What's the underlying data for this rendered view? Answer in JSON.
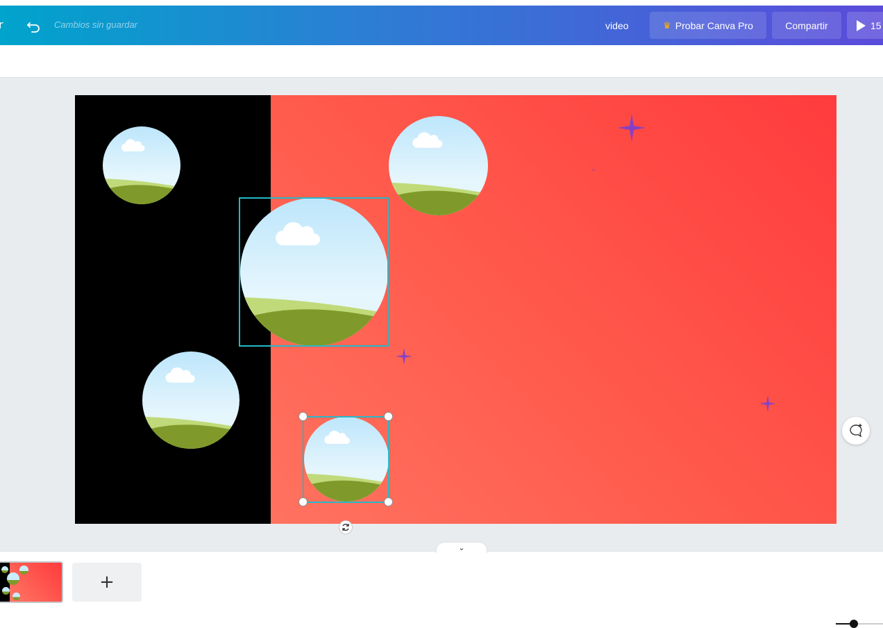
{
  "toolbar": {
    "edge_glyph": "r",
    "save_status": "Cambios sin guardar",
    "video_link": "video",
    "pro_label": "Probar Canva Pro",
    "share_label": "Compartir",
    "play_label": "15"
  },
  "bottom": {
    "add_page_label": "+",
    "collapse_glyph": "⌄"
  },
  "colors": {
    "brand_gradient_start": "#00a4cc",
    "brand_gradient_end": "#5b4bdb",
    "selection": "#26b8c9",
    "canvas_red": "#ff3b3d",
    "canvas_coral": "#ff7d68",
    "sparkle": "#7b3fd1"
  }
}
